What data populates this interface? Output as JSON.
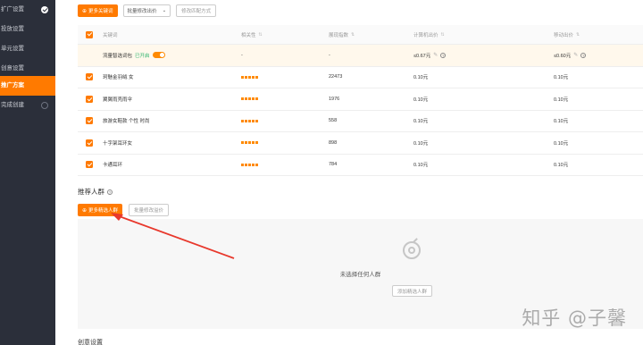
{
  "sidebar": {
    "items": [
      {
        "label": "扩广设置",
        "status": "done"
      },
      {
        "label": "投放设置"
      },
      {
        "label": "单元设置"
      },
      {
        "label": "创意设置"
      },
      {
        "label": "推广方案",
        "active": true
      },
      {
        "label": "完成创建",
        "status": "pending"
      }
    ]
  },
  "toolbar": {
    "add_keywords": "更多关键词",
    "bid_select": "批量修改出价",
    "match_button": "修改匹配方式"
  },
  "table": {
    "headers": {
      "keyword": "关键词",
      "relevance": "相关性",
      "hotness": "展现指数",
      "pc_bid": "计算机出价",
      "mobile_bid": "移动出价"
    },
    "special_row": {
      "keyword": "流量智选词包",
      "status": "已开启",
      "relevance": "-",
      "hotness": "-",
      "pc_bid": "≤0.67元",
      "mobile_bid": "≤0.60元"
    },
    "rows": [
      {
        "keyword": "珂魅金羽绒 女",
        "hotness": "22473",
        "pc_bid": "0.10元",
        "mobile_bid": "0.10元"
      },
      {
        "keyword": "翼翼雨壳雨伞",
        "hotness": "1976",
        "pc_bid": "0.10元",
        "mobile_bid": "0.10元"
      },
      {
        "keyword": "旅游女鞋款 个性 时尚",
        "hotness": "558",
        "pc_bid": "0.10元",
        "mobile_bid": "0.10元"
      },
      {
        "keyword": "十字架耳环女",
        "hotness": "898",
        "pc_bid": "0.10元",
        "mobile_bid": "0.10元"
      },
      {
        "keyword": "卡通耳环",
        "hotness": "784",
        "pc_bid": "0.10元",
        "mobile_bid": "0.10元"
      }
    ]
  },
  "crowd": {
    "title": "推荐人群",
    "add_button": "更多精选人群",
    "batch_button": "批量修改溢价",
    "empty_text": "未选择任何人群",
    "empty_button": "添加精选人群"
  },
  "watermark": "知乎 @子馨",
  "bottom_text": "创意设置",
  "colors": {
    "accent": "#ff7a00",
    "sidebar_bg": "#2b2f3a",
    "arrow": "#e8382c"
  }
}
